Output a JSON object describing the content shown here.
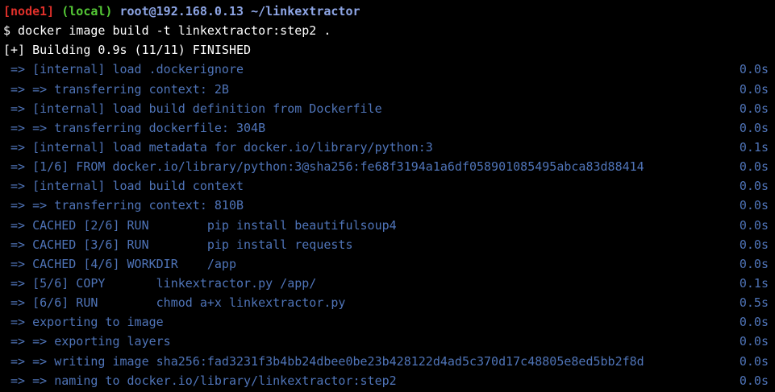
{
  "colors": {
    "background": "#000000",
    "node": "#e0302a",
    "local": "#55c936",
    "userhost": "#8ea6e6",
    "command": "#ffffff",
    "output": "#4f74b8"
  },
  "prompt": {
    "node": "[node1]",
    "local": "(local)",
    "userhost": "root@192.168.0.13",
    "path": "~/linkextractor"
  },
  "command": "$ docker image build -t linkextractor:step2 .",
  "status": "[+] Building 0.9s (11/11) FINISHED",
  "steps": [
    {
      "text": " => [internal] load .dockerignore",
      "time": "0.0s"
    },
    {
      "text": " => => transferring context: 2B",
      "time": "0.0s"
    },
    {
      "text": " => [internal] load build definition from Dockerfile",
      "time": "0.0s"
    },
    {
      "text": " => => transferring dockerfile: 304B",
      "time": "0.0s"
    },
    {
      "text": " => [internal] load metadata for docker.io/library/python:3",
      "time": "0.1s"
    },
    {
      "text": " => [1/6] FROM docker.io/library/python:3@sha256:fe68f3194a1a6df058901085495abca83d88414",
      "time": "0.0s"
    },
    {
      "text": " => [internal] load build context",
      "time": "0.0s"
    },
    {
      "text": " => => transferring context: 810B",
      "time": "0.0s"
    },
    {
      "text": " => CACHED [2/6] RUN        pip install beautifulsoup4",
      "time": "0.0s"
    },
    {
      "text": " => CACHED [3/6] RUN        pip install requests",
      "time": "0.0s"
    },
    {
      "text": " => CACHED [4/6] WORKDIR    /app",
      "time": "0.0s"
    },
    {
      "text": " => [5/6] COPY       linkextractor.py /app/",
      "time": "0.1s"
    },
    {
      "text": " => [6/6] RUN        chmod a+x linkextractor.py",
      "time": "0.5s"
    },
    {
      "text": " => exporting to image",
      "time": "0.0s"
    },
    {
      "text": " => => exporting layers",
      "time": "0.0s"
    },
    {
      "text": " => => writing image sha256:fad3231f3b4bb24dbee0be23b428122d4ad5c370d17c48805e8ed5bb2f8d",
      "time": "0.0s"
    },
    {
      "text": " => => naming to docker.io/library/linkextractor:step2",
      "time": "0.0s"
    }
  ]
}
